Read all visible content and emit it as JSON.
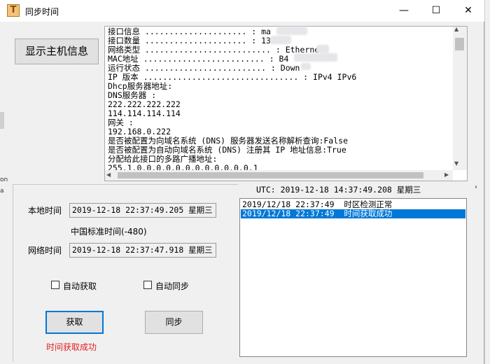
{
  "window": {
    "title": "同步时间",
    "icon_glyph": "T",
    "minimize_glyph": "—",
    "maximize_glyph": "☐",
    "close_glyph": "✕"
  },
  "buttons": {
    "show_host_info": "显示主机信息",
    "fetch": "获取",
    "sync": "同步"
  },
  "info_lines": [
    "接口信息 ..................... : ma",
    "接口数量 ..................... : 13",
    "网络类型 .......................... : Etherne",
    "MAC地址 ......................... : B4",
    "运行状态 ......................... : Down",
    "IP 版本 ................................ : IPv4 IPv6",
    "Dhcp服务器地址:",
    "DNS服务器 :",
    "222.222.222.222",
    "114.114.114.114",
    "网关 :",
    "192.168.0.222",
    "是否被配置为向域名系统 (DNS) 服务器发送名称解析查询:False",
    "是否被配置为自动向域名系统 (DNS) 注册其 IP 地址信息:True",
    "分配给此接口的多路广播地址:",
    "255.1.0.0.0.0.0.0.0.0.0.0.0.0.1"
  ],
  "time_panel": {
    "local_time_label": "本地时间",
    "local_time_value": "2019-12-18 22:37:49.205 星期三",
    "timezone": "中国标准时间(-480)",
    "network_time_label": "网络时间",
    "network_time_value": "2019-12-18 22:37:47.918 星期三",
    "auto_fetch_label": "自动获取",
    "auto_sync_label": "自动同步",
    "status": "时间获取成功"
  },
  "utc_text": "UTC:  2019-12-18 14:37:49.208 星期三",
  "log_entries": [
    "2019/12/18 22:37:49  时区检测正常",
    "2019/12/18 22:37:49  时间获取成功"
  ],
  "scroll_glyphs": {
    "up": "▲",
    "down": "▼",
    "left": "◀",
    "right": "▶",
    "side": "‹"
  },
  "edge_text": {
    "on": "on",
    "a": "a"
  },
  "colors": {
    "selection": "#0078d7",
    "status_text": "#e02020",
    "focus_border": "#0078d7"
  }
}
